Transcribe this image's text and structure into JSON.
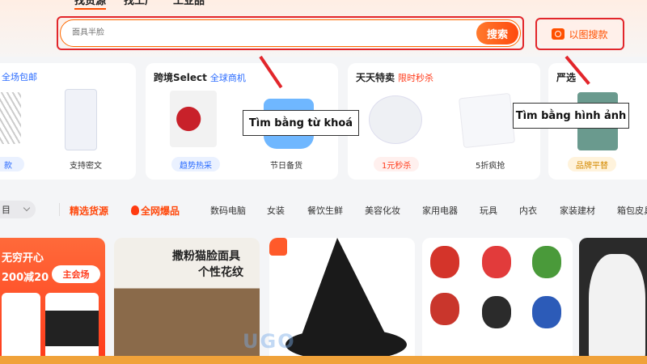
{
  "top_tabs": [
    "找货源",
    "找工厂",
    "工业品"
  ],
  "search": {
    "placeholder": "面具半脸",
    "button_label": "搜索"
  },
  "image_search": {
    "label": "以图搜款"
  },
  "cards": [
    {
      "title": "",
      "sub": "全场包邮",
      "sub_color": "#2b6cff",
      "items": [
        {
          "label": "款"
        },
        {
          "label": "支持密文"
        }
      ]
    },
    {
      "title": "跨境Select",
      "sub": "全球商机",
      "sub_color": "#2b6cff",
      "items": [
        {
          "label": "趋势热采"
        },
        {
          "label": "节日备货"
        }
      ]
    },
    {
      "title": "天天特卖",
      "sub": "限时秒杀",
      "sub_color": "#ff3a1a",
      "items": [
        {
          "label": "1元秒杀"
        },
        {
          "label": "5折疯抢"
        }
      ]
    },
    {
      "title": "严选",
      "sub": "",
      "sub_color": "#2b6cff",
      "items": [
        {
          "label": "品牌平替"
        }
      ]
    }
  ],
  "nav": {
    "select_label": "目",
    "items": [
      "精选货源",
      "全网爆品",
      "数码电脑",
      "女装",
      "餐饮生鲜",
      "美容化妆",
      "家用电器",
      "玩具",
      "内衣",
      "家装建材",
      "箱包皮具"
    ]
  },
  "feed": {
    "promo_line1": "无穷开心",
    "promo_line2": "200减20",
    "promo_button": "主会场",
    "mask_caption_line1": "撒粉猫脸面具",
    "mask_caption_line2": "个性花纹"
  },
  "annotations": {
    "keyword_search": "Tìm bằng từ khoá",
    "image_search": "Tìm bằng hình ảnh"
  },
  "watermark": "UGO",
  "colors": {
    "accent": "#ff5000",
    "annotation_red": "#e2262b"
  }
}
